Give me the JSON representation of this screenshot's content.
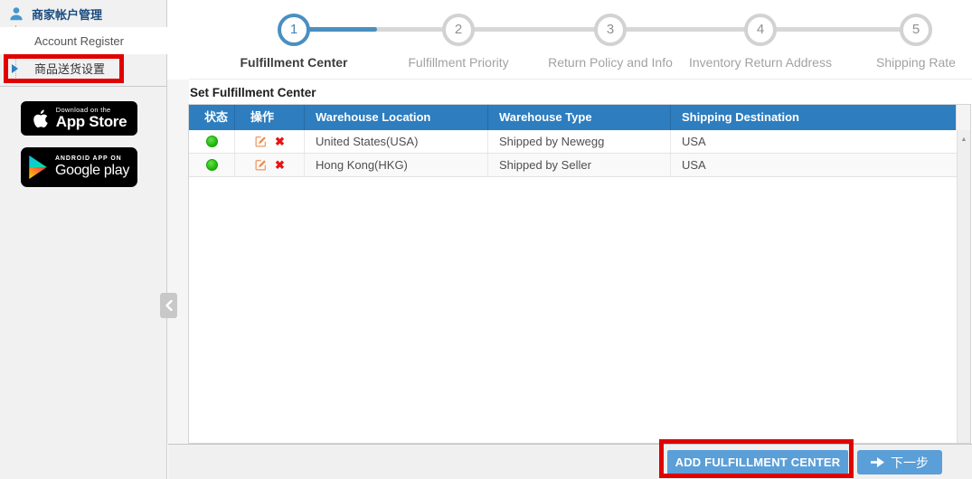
{
  "sidebar": {
    "section": {
      "label": "商家帐户管理"
    },
    "items": [
      {
        "label": "Account Register"
      },
      {
        "label": "商品送货设置"
      }
    ],
    "badges": {
      "app_store": {
        "line1": "Download on the",
        "line2": "App Store"
      },
      "google_play": {
        "line1": "ANDROID APP ON",
        "line2": "Google play"
      }
    }
  },
  "stepper": {
    "steps": [
      {
        "number": "1",
        "label": "Fulfillment Center",
        "state": "active"
      },
      {
        "number": "2",
        "label": "Fulfillment Priority",
        "state": "upcoming"
      },
      {
        "number": "3",
        "label": "Return Policy and Info",
        "state": "upcoming"
      },
      {
        "number": "4",
        "label": "Inventory Return Address",
        "state": "upcoming"
      },
      {
        "number": "5",
        "label": "Shipping Rate",
        "state": "upcoming"
      }
    ]
  },
  "main": {
    "section_title": "Set Fulfillment Center",
    "table": {
      "headers": [
        "状态",
        "操作",
        "Warehouse Location",
        "Warehouse Type",
        "Shipping Destination"
      ],
      "rows": [
        {
          "status": "active",
          "location": "United States(USA)",
          "type": "Shipped by Newegg",
          "destination": "USA"
        },
        {
          "status": "active",
          "location": "Hong Kong(HKG)",
          "type": "Shipped by Seller",
          "destination": "USA"
        }
      ]
    },
    "footer": {
      "add_button": "ADD FULFILLMENT CENTER",
      "next_button": "下一步"
    }
  },
  "icons": {
    "delete": "✖",
    "scroll_up": "▲"
  },
  "colors": {
    "table_header_blue": "#2d7dbf",
    "button_blue": "#5b9fd8",
    "stepper_blue": "#4a8fc0",
    "annotation_red": "#e00000",
    "status_green": "#2bc20e",
    "badge_black": "#000000"
  }
}
